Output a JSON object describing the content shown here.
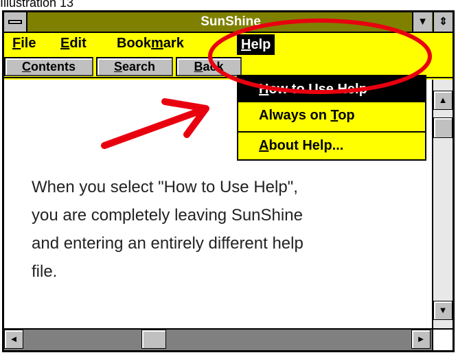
{
  "caption": "Illustration 13",
  "window": {
    "title": "SunShine"
  },
  "titlebar_buttons": {
    "minimize_glyph": "▼",
    "restore_glyph": "⇕"
  },
  "menu": [
    {
      "label_pre": "",
      "label_u": "F",
      "label_post": "ile"
    },
    {
      "label_pre": "",
      "label_u": "E",
      "label_post": "dit"
    },
    {
      "label_pre": "Book",
      "label_u": "m",
      "label_post": "ark"
    },
    {
      "label_pre": "",
      "label_u": "H",
      "label_post": "elp"
    }
  ],
  "toolbar": [
    {
      "label_u": "C",
      "label_post": "ontents"
    },
    {
      "label_u": "S",
      "label_post": "earch"
    },
    {
      "label_u": "B",
      "label_post": "ack"
    }
  ],
  "help_menu": {
    "items": [
      {
        "label_u": "H",
        "label_post": "ow to Use Help",
        "selected": true
      },
      {
        "label_pre": "Always on ",
        "label_u": "T",
        "label_post": "op",
        "selected": false
      },
      {
        "label_u": "A",
        "label_post": "bout Help...",
        "selected": false
      }
    ]
  },
  "content": {
    "lines": [
      "When you select \"How to Use Help\",",
      "you are completely leaving SunShine",
      "and entering an entirely different help",
      "file."
    ]
  },
  "scroll_glyphs": {
    "up": "▲",
    "down": "▼",
    "left": "◄",
    "right": "►"
  },
  "colors": {
    "menu_bg": "#ffff00",
    "title_bg": "#808000",
    "annotation": "#e8000f"
  }
}
